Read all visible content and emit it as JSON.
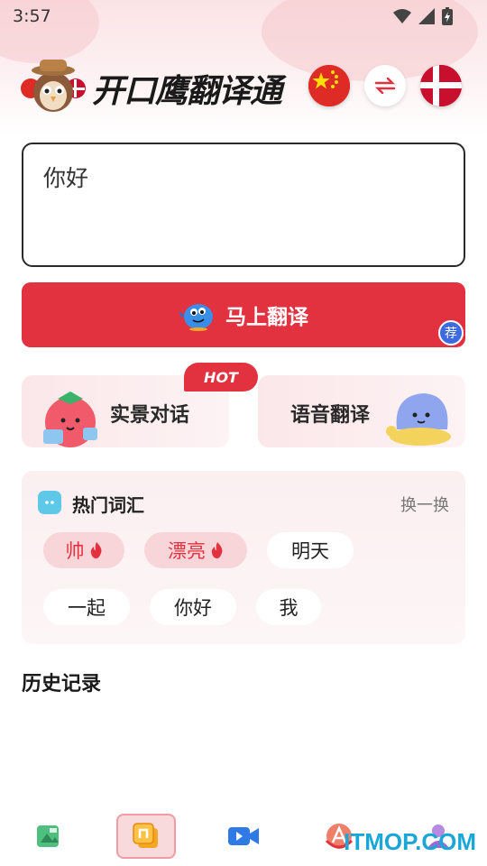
{
  "status_bar": {
    "time": "3:57"
  },
  "header": {
    "app_title": "开口鹰翻译通",
    "source_flag": "china-flag",
    "target_flag": "denmark-flag",
    "swap_icon": "swap-arrows-icon"
  },
  "input": {
    "value": "你好"
  },
  "translate_button": {
    "label": "马上翻译",
    "badge": "荐"
  },
  "features": {
    "scene": {
      "label": "实景对话",
      "tag": "HOT"
    },
    "voice": {
      "label": "语音翻译"
    }
  },
  "hot_words": {
    "title": "热门词汇",
    "refresh": "换一换",
    "row1": [
      {
        "text": "帅",
        "hot": true
      },
      {
        "text": "漂亮",
        "hot": true
      },
      {
        "text": "明天",
        "hot": false
      }
    ],
    "row2": [
      {
        "text": "一起",
        "hot": false
      },
      {
        "text": "你好",
        "hot": false
      },
      {
        "text": "我",
        "hot": false
      }
    ]
  },
  "history": {
    "title": "历史记录"
  },
  "bottom_nav": {
    "items": [
      "photo-translate-icon",
      "home-translate-icon",
      "video-icon",
      "font-a-icon",
      "profile-icon"
    ],
    "active_index": 1
  },
  "watermark": "ITMOP.COM",
  "colors": {
    "accent": "#e3323f",
    "badge": "#3d6ae0"
  }
}
